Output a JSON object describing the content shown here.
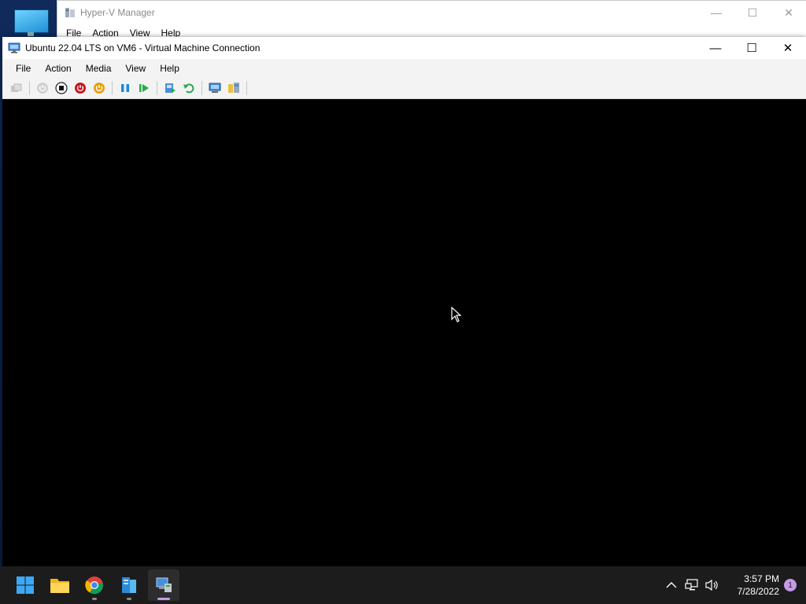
{
  "background_window": {
    "title": "Hyper-V Manager",
    "menu": [
      "File",
      "Action",
      "View",
      "Help"
    ]
  },
  "vm_window": {
    "title": "Ubuntu 22.04 LTS on VM6 - Virtual Machine Connection",
    "menu": [
      "File",
      "Action",
      "Media",
      "View",
      "Help"
    ],
    "toolbar_icons": [
      "ctrl-alt-del-icon",
      "start-icon",
      "turn-off-icon",
      "shut-down-icon",
      "save-icon",
      "pause-icon",
      "reset-icon",
      "checkpoint-icon",
      "revert-icon",
      "enhanced-session-icon",
      "zoom-icon"
    ]
  },
  "taskbar": {
    "apps": [
      "start-icon",
      "file-explorer-icon",
      "chrome-icon",
      "server-manager-icon",
      "hyper-v-icon"
    ],
    "time": "3:57 PM",
    "date": "7/28/2022",
    "notifications": "1"
  },
  "colors": {
    "accent": "#c59ae8",
    "taskbar": "#1c1c1c"
  }
}
